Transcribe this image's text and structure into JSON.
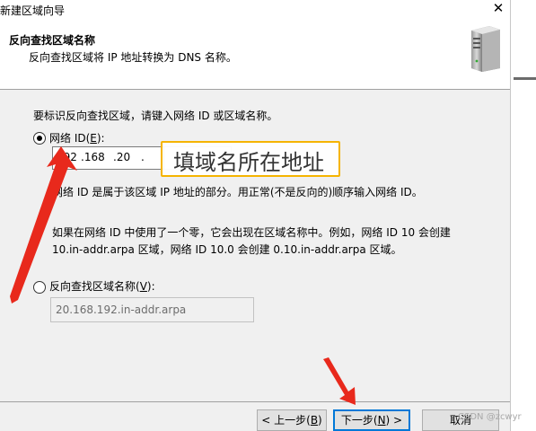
{
  "window": {
    "title": "新建区域向导",
    "close_glyph": "✕"
  },
  "header": {
    "title": "反向查找区域名称",
    "subtitle": "反向查找区域将 IP 地址转换为 DNS 名称。",
    "icon": "server-icon"
  },
  "main": {
    "instruction": "要标识反向查找区域，请键入网络 ID 或区域名称。",
    "network_id": {
      "label": "网络 ID(",
      "accel": "E",
      "label_end": "):",
      "selected": true,
      "octets": [
        "192",
        ".168",
        ".20",
        "."
      ]
    },
    "network_id_help": "网络 ID 是属于该区域 IP 地址的部分。用正常(不是反向的)顺序输入网络 ID。",
    "zero_note_line1": "如果在网络 ID 中使用了一个零，它会出现在区域名称中。例如，网络 ID 10 会创建",
    "zero_note_line2": "10.in-addr.arpa 区域，网络 ID 10.0 会创建 0.10.in-addr.arpa 区域。",
    "zone_name": {
      "label": "反向查找区域名称(",
      "accel": "V",
      "label_end": "):",
      "selected": false,
      "value": "20.168.192.in-addr.arpa"
    }
  },
  "annotation": {
    "text": "填域名所在地址",
    "color": "#f5b400",
    "arrow_color": "#e8291c"
  },
  "footer": {
    "back_label": "< 上一步(",
    "back_accel": "B",
    "back_end": ")",
    "next_label": "下一步(",
    "next_accel": "N",
    "next_end": ") >",
    "cancel_label": "取消"
  },
  "watermark": "CSDN @zcwyr"
}
